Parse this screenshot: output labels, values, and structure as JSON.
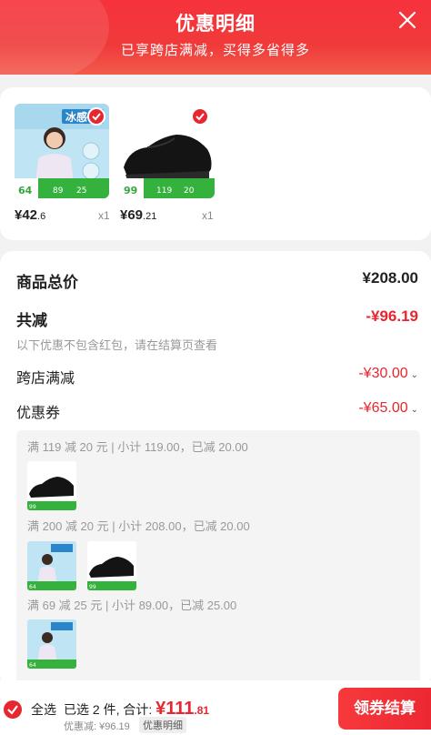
{
  "header": {
    "title": "优惠明细",
    "subtitle": "已享跨店满减，买得多省得多"
  },
  "products": [
    {
      "price_main": "¥42",
      "price_dec": ".6",
      "qty": "x1",
      "image": "woman-in-tshirt-product",
      "banner_text": "冰感",
      "checked": true
    },
    {
      "price_main": "¥69",
      "price_dec": ".21",
      "qty": "x1",
      "image": "black-running-shoe-product",
      "checked": true
    }
  ],
  "summary": {
    "total_label": "商品总价",
    "total_value": "¥208.00",
    "reduce_label": "共减",
    "reduce_value": "-¥96.19",
    "note": "以下优惠不包含红包，请在结算页查看",
    "cross_store_label": "跨店满减",
    "cross_store_value": "-¥30.00",
    "coupon_label": "优惠券",
    "coupon_value": "-¥65.00"
  },
  "rules": [
    "满 119 减 20 元 | 小计 119.00，已减 20.00",
    "满 200 减 20 元 | 小计 208.00，已减 20.00",
    "满 69 减 25 元 | 小计 89.00，已减 25.00"
  ],
  "bottom": {
    "select_all": "全选",
    "selected_text": "已选 2 件, 合计: ",
    "total_main": "¥111",
    "total_dec": ".81",
    "discount": "优惠减: ¥96.19",
    "detail_link": "优惠明细",
    "checkout": "领券结算"
  },
  "colors": {
    "accent": "#e8262f",
    "header": "#f03a3a"
  }
}
